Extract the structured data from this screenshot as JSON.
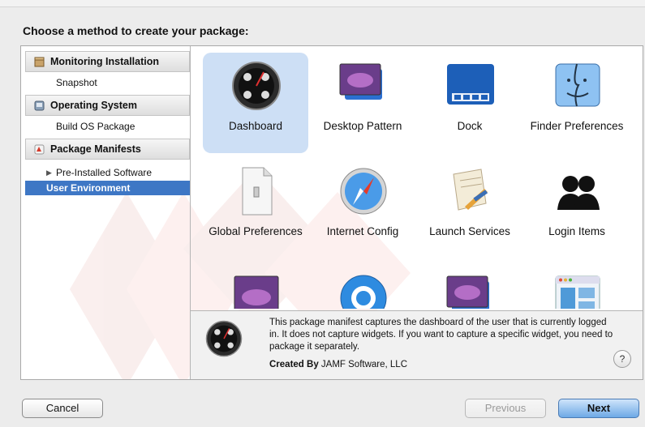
{
  "heading": "Choose a method to create your package:",
  "sidebar": {
    "sections": [
      {
        "label": "Monitoring Installation",
        "icon": "installer-box-icon",
        "items": [
          {
            "label": "Snapshot"
          }
        ]
      },
      {
        "label": "Operating System",
        "icon": "os-installer-icon",
        "items": [
          {
            "label": "Build OS Package"
          }
        ]
      },
      {
        "label": "Package Manifests",
        "icon": "package-manifest-icon",
        "items": [
          {
            "label": "Pre-Installed Software",
            "disclosure": "▶"
          },
          {
            "label": "User Environment",
            "selected": true
          }
        ]
      }
    ]
  },
  "grid": {
    "items": [
      {
        "label": "Dashboard",
        "icon": "dashboard-icon",
        "selected": true
      },
      {
        "label": "Desktop Pattern",
        "icon": "desktop-pattern-icon"
      },
      {
        "label": "Dock",
        "icon": "dock-icon"
      },
      {
        "label": "Finder Preferences",
        "icon": "finder-icon"
      },
      {
        "label": "Global Preferences",
        "icon": "global-preferences-icon"
      },
      {
        "label": "Internet Config",
        "icon": "safari-compass-icon"
      },
      {
        "label": "Launch Services",
        "icon": "launch-services-icon"
      },
      {
        "label": "Login Items",
        "icon": "login-items-users-icon"
      },
      {
        "label": "",
        "icon": "desktop-screenshot-icon"
      },
      {
        "label": "",
        "icon": "quicktime-icon"
      },
      {
        "label": "",
        "icon": "desktop-pattern-icon"
      },
      {
        "label": "",
        "icon": "window-layout-icon"
      }
    ]
  },
  "description": {
    "text": "This package manifest captures the dashboard of the user that is currently logged in. It does not capture widgets. If you want to capture a specific widget, you need to package it separately.",
    "created_by_label": "Created By",
    "created_by_value": "JAMF Software, LLC",
    "help_label": "?"
  },
  "buttons": {
    "cancel": "Cancel",
    "previous": "Previous",
    "next": "Next"
  }
}
